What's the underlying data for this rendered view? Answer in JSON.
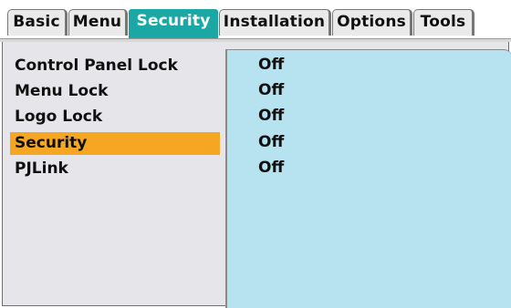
{
  "tabs": [
    {
      "label": "Basic",
      "active": false
    },
    {
      "label": "Menu",
      "active": false
    },
    {
      "label": "Security",
      "active": true
    },
    {
      "label": "Installation",
      "active": false
    },
    {
      "label": "Options",
      "active": false
    },
    {
      "label": "Tools",
      "active": false
    }
  ],
  "menu": {
    "items": [
      {
        "label": "Control Panel Lock",
        "value": "Off",
        "selected": false
      },
      {
        "label": "Menu Lock",
        "value": "Off",
        "selected": false
      },
      {
        "label": "Logo Lock",
        "value": "Off",
        "selected": false
      },
      {
        "label": "Security",
        "value": "Off",
        "selected": true
      },
      {
        "label": "PJLink",
        "value": "Off",
        "selected": false
      }
    ]
  },
  "colors": {
    "active_tab": "#1ba7a4",
    "selected_item": "#f5a623",
    "value_panel": "#b6e3ef",
    "list_panel": "#e6e6ea"
  }
}
